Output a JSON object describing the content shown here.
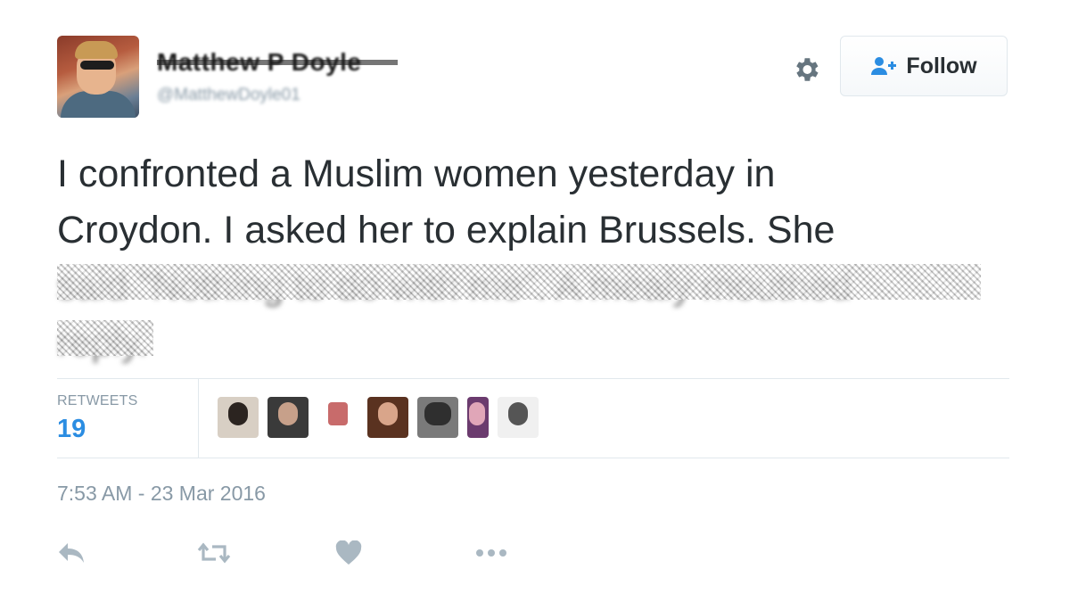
{
  "author": {
    "name": "Matthew P Doyle",
    "handle": "@MatthewDoyle01"
  },
  "header": {
    "follow_label": "Follow",
    "icons": [
      "gear-icon",
      "add-user-icon"
    ]
  },
  "tweet": {
    "lines": [
      "I confronted a Muslim women yesterday in",
      "Croydon. I asked her to explain Brussels. She"
    ],
    "censored_lines": [
      "said \"Nothing to do with me\". A mealy mouthed",
      "reply."
    ]
  },
  "stats": {
    "retweets_label": "RETWEETS",
    "retweets_count": "19",
    "retweeter_avatars": 8
  },
  "timestamp": "7:53 AM - 23 Mar 2016",
  "actions": [
    "reply-icon",
    "retweet-icon",
    "like-icon",
    "more-icon"
  ],
  "colors": {
    "accent": "#2b8de2",
    "muted": "#8899a6",
    "text": "#292f33",
    "border": "#e1e8ed"
  }
}
